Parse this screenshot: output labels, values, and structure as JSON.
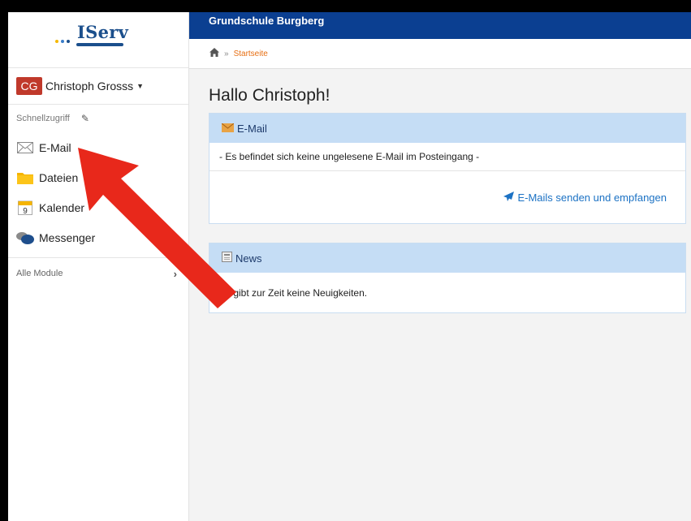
{
  "header": {
    "school": "Grundschule Burgberg"
  },
  "logo": {
    "text": "IServ",
    "dot_colors": [
      "#f5b800",
      "#3a7dc9",
      "#1b4f8c"
    ]
  },
  "user": {
    "initials": "CG",
    "name": "Christoph Grosss",
    "avatar_color": "#c0392b"
  },
  "sidebar": {
    "quick_label": "Schnellzugriff",
    "items": [
      {
        "label": "E-Mail",
        "icon": "envelope-icon"
      },
      {
        "label": "Dateien",
        "icon": "folder-icon"
      },
      {
        "label": "Kalender",
        "icon": "calendar-icon",
        "icon_text": "9"
      },
      {
        "label": "Messenger",
        "icon": "chat-icon"
      }
    ],
    "modules_label": "Alle Module"
  },
  "breadcrumb": {
    "separator": "»",
    "current": "Startseite"
  },
  "greeting": "Hallo Christoph!",
  "email_panel": {
    "title": "E-Mail",
    "message": "- Es befindet sich keine ungelesene E-Mail im Posteingang -",
    "action": "E-Mails senden und empfangen"
  },
  "news_panel": {
    "title": "News",
    "message": "Es gibt zur Zeit keine Neuigkeiten."
  },
  "colors": {
    "topbar": "#0b3f91",
    "panel_head": "#c5ddf5",
    "link": "#1c72c4",
    "crumb_link": "#e66e12",
    "arrow": "#e8281b"
  }
}
